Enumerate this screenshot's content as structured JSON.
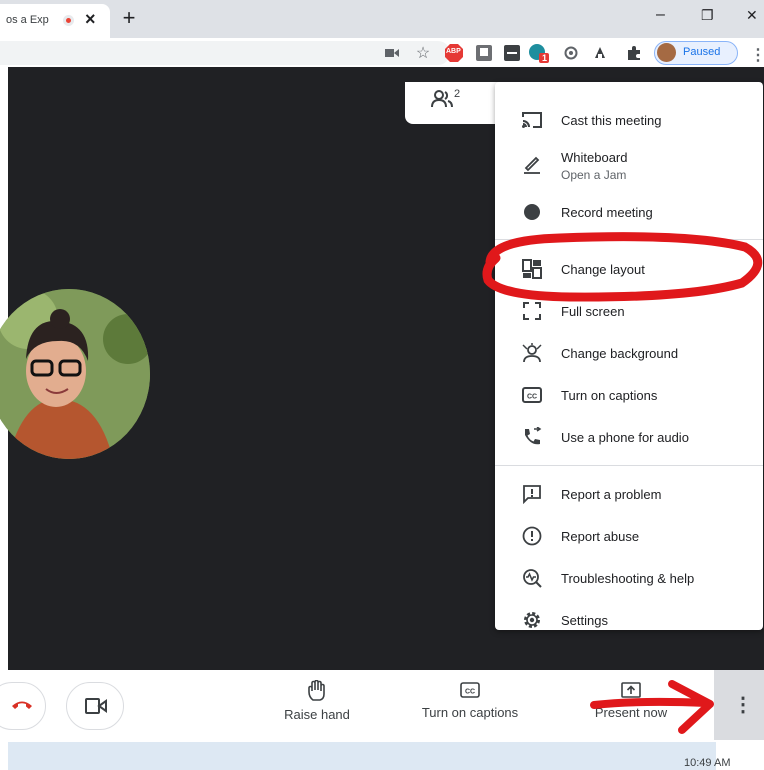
{
  "browser": {
    "tab_title": "os a Exp",
    "tab_close": "×",
    "new_tab": "+",
    "window_minimize": "–",
    "window_restore": "❐",
    "window_close": "✕",
    "profile_status": "Paused",
    "more_menu_glyph": "⋮",
    "extensions": [
      "camera-icon",
      "star-icon",
      "adblock-icon",
      "extension-icon",
      "extension-icon",
      "extension-icon",
      "extension-icon",
      "puzzle-icon"
    ],
    "adblock_label": "ABP",
    "badge_count": "1"
  },
  "meet": {
    "participants_count": "2",
    "menu": {
      "items": [
        {
          "label": "Cast this meeting",
          "icon": "cast-icon"
        },
        {
          "label": "Whiteboard",
          "sublabel": "Open a Jam",
          "icon": "pencil-icon"
        },
        {
          "label": "Record meeting",
          "icon": "record-icon"
        },
        {
          "label": "Change layout",
          "icon": "layout-icon"
        },
        {
          "label": "Full screen",
          "icon": "fullscreen-icon"
        },
        {
          "label": "Change background",
          "icon": "background-icon"
        },
        {
          "label": "Turn on captions",
          "icon": "captions-icon"
        },
        {
          "label": "Use a phone for audio",
          "icon": "phone-audio-icon"
        },
        {
          "label": "Report a problem",
          "icon": "report-problem-icon"
        },
        {
          "label": "Report abuse",
          "icon": "report-abuse-icon"
        },
        {
          "label": "Troubleshooting & help",
          "icon": "troubleshoot-icon"
        },
        {
          "label": "Settings",
          "icon": "settings-icon"
        }
      ]
    },
    "bottom_bar": {
      "raise_hand": "Raise hand",
      "captions": "Turn on captions",
      "present": "Present now",
      "more_glyph": "⋮"
    },
    "clock": "10:49 AM"
  },
  "colors": {
    "stage": "#202124",
    "annotation_red": "#e0181b",
    "hangup_red": "#d93025"
  }
}
